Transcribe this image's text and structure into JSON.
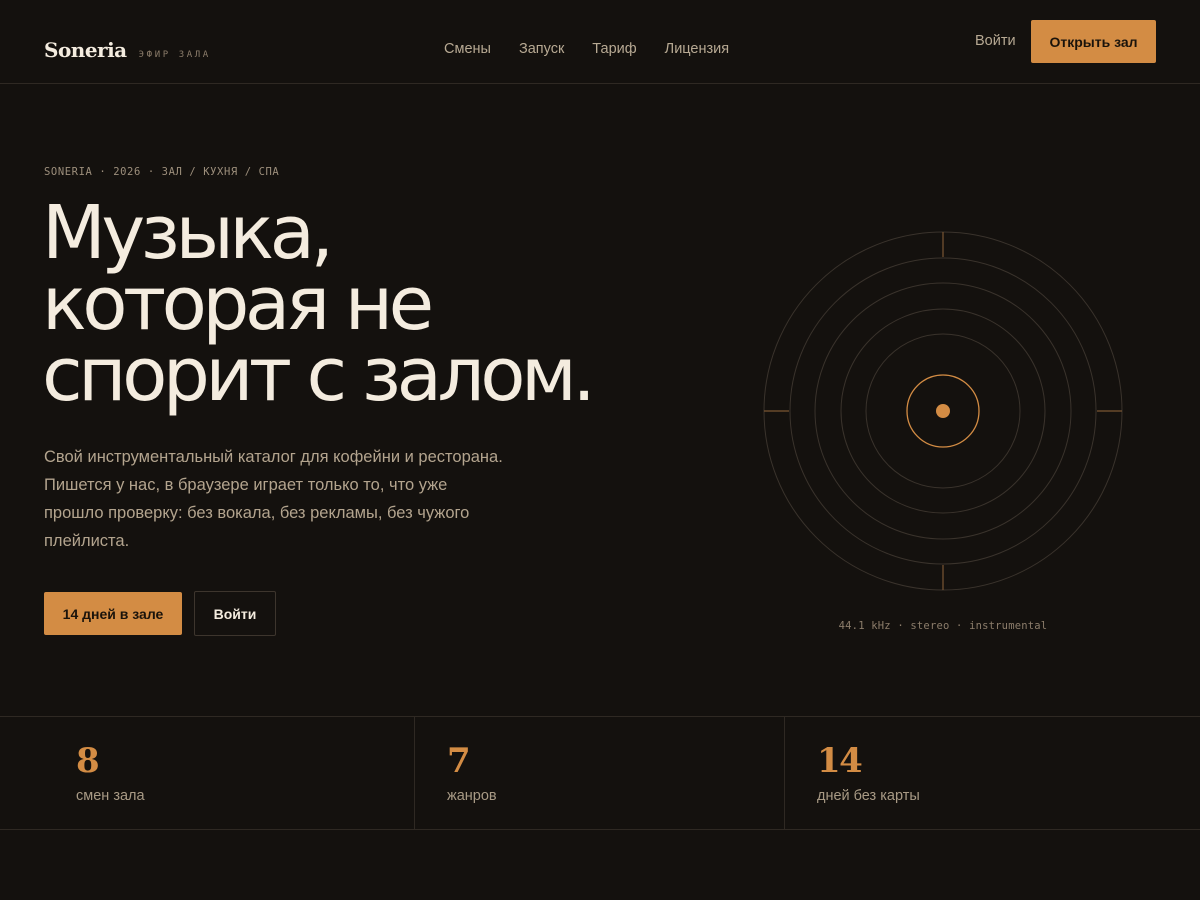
{
  "header": {
    "brand": "Soneria",
    "tagline": "ЭФИР ЗАЛА",
    "nav": [
      "Смены",
      "Запуск",
      "Тариф",
      "Лицензия"
    ],
    "login": "Войти",
    "cta": "Открыть зал"
  },
  "hero": {
    "eyebrow": "SONERIA · 2026 · ЗАЛ / КУХНЯ / СПА",
    "headline": [
      "Музыка,",
      "которая не",
      "спорит с залом."
    ],
    "lead": "Свой инструментальный каталог для кофейни и ресторана. Пишется у нас, в браузере играет только то, что уже прошло проверку: без вокала, без рекламы, без чужого плейлиста.",
    "primary_cta": "14 дней в зале",
    "secondary_cta": "Войти"
  },
  "disc": {
    "caption": "44.1 kHz · stereo · instrumental",
    "accent": "#d38c44"
  },
  "stats": [
    {
      "value": "8",
      "label": "смен зала"
    },
    {
      "value": "7",
      "label": "жанров"
    },
    {
      "value": "14",
      "label": "дней без карты"
    }
  ],
  "colors": {
    "background": "#14110e",
    "accent": "#d38c44",
    "text": "#f4ecdf",
    "muted": "#b3a48e"
  }
}
